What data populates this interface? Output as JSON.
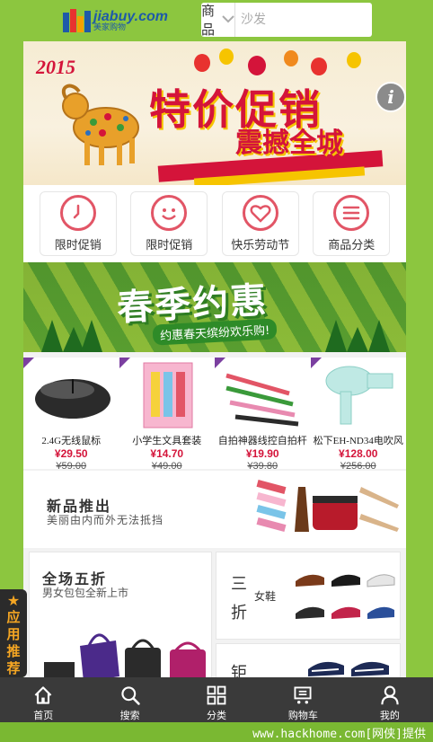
{
  "header": {
    "logo_text": "jiabuy.com",
    "logo_sub": "美家购物",
    "search_category": "商品",
    "search_placeholder": "沙发"
  },
  "banner": {
    "year": "2015",
    "title": "特价促销",
    "subtitle": "震撼全城",
    "info_icon": "info-icon"
  },
  "categories": [
    {
      "label": "限时促销",
      "icon": "clock-icon"
    },
    {
      "label": "限时促销",
      "icon": "smile-icon"
    },
    {
      "label": "快乐劳动节",
      "icon": "heart-icon"
    },
    {
      "label": "商品分类",
      "icon": "menu-icon"
    }
  ],
  "spring_banner": {
    "title": "春季约惠",
    "subtitle": "约惠春天缤纷欢乐购!"
  },
  "products": [
    {
      "name": "2.4G无线鼠标",
      "price": "¥29.50",
      "old_price": "¥59.00"
    },
    {
      "name": "小学生文具套装",
      "price": "¥14.70",
      "old_price": "¥49.00"
    },
    {
      "name": "自拍神器线控自拍杆",
      "price": "¥19.90",
      "old_price": "¥39.80"
    },
    {
      "name": "松下EH-ND34电吹风",
      "price": "¥128.00",
      "old_price": "¥256.00"
    }
  ],
  "new_arrivals": {
    "title": "新品推出",
    "subtitle": "美丽由内而外无法抵挡"
  },
  "sale_box": {
    "title": "全场五折",
    "subtitle": "男女包包全新上市"
  },
  "shoes_box": {
    "title": "三折",
    "subtitle": "女鞋"
  },
  "third_box": {
    "title": "钜"
  },
  "side_tab": {
    "label": "应用推荐"
  },
  "bottom_nav": [
    {
      "label": "首页",
      "icon": "home-icon"
    },
    {
      "label": "搜索",
      "icon": "search-icon"
    },
    {
      "label": "分类",
      "icon": "grid-icon"
    },
    {
      "label": "购物车",
      "icon": "cart-icon"
    },
    {
      "label": "我的",
      "icon": "user-icon"
    }
  ],
  "watermark": "www.hackhome.com[网侠]提供"
}
